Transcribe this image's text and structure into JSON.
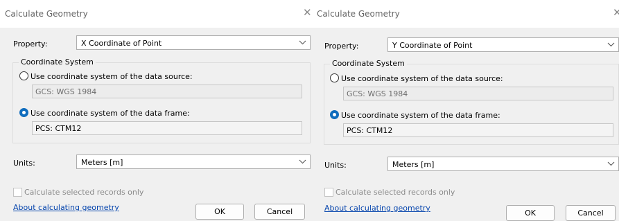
{
  "dialogs": [
    {
      "title": "Calculate Geometry",
      "property_label": "Property:",
      "property_value": "X Coordinate of Point",
      "coord_group_label": "Coordinate System",
      "source_option": "Use coordinate system of the data source:",
      "source_value": "GCS: WGS 1984",
      "frame_option": "Use coordinate system of the data frame:",
      "frame_value": "PCS: CTM12",
      "selected_option": "frame",
      "units_label": "Units:",
      "units_value": "Meters [m]",
      "selected_only_label": "Calculate selected records only",
      "selected_only_checked": false,
      "about_link": "About calculating geometry",
      "ok_label": "OK",
      "cancel_label": "Cancel"
    },
    {
      "title": "Calculate Geometry",
      "property_label": "Property:",
      "property_value": "Y Coordinate of Point",
      "coord_group_label": "Coordinate System",
      "source_option": "Use coordinate system of the data source:",
      "source_value": "GCS: WGS 1984",
      "frame_option": "Use coordinate system of the data frame:",
      "frame_value": "PCS: CTM12",
      "selected_option": "frame",
      "units_label": "Units:",
      "units_value": "Meters [m]",
      "selected_only_label": "Calculate selected records only",
      "selected_only_checked": false,
      "about_link": "About calculating geometry",
      "ok_label": "OK",
      "cancel_label": "Cancel"
    }
  ],
  "colors": {
    "accent": "#0f6cbd",
    "link": "#0645ad",
    "titlebar": "#ffffff",
    "dialog_bg": "#f0f0f0"
  },
  "icons": {
    "close": "close-icon",
    "dropdown": "chevron-down-icon"
  }
}
